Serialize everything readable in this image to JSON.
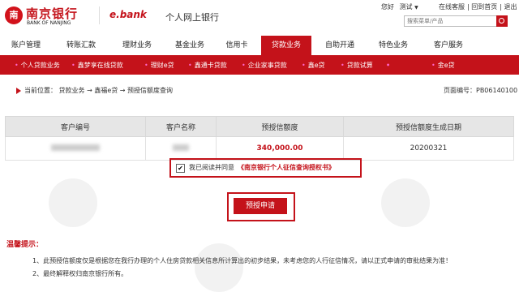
{
  "header": {
    "logo_seal": "南",
    "bank_name": "南京银行",
    "bank_name_en": "BANK OF NANJING",
    "ebank": "e.bank",
    "site_title": "个人网上银行",
    "greeting": "您好",
    "user": "测试",
    "links": [
      "在线客服",
      "回到首页",
      "退出"
    ],
    "search_placeholder": "搜索菜单/产品"
  },
  "main_nav": {
    "items": [
      "账户管理",
      "转账汇款",
      "理财业务",
      "基金业务",
      "信用卡",
      "贷款业务",
      "自助开通",
      "特色业务",
      "客户服务"
    ],
    "active": "贷款业务"
  },
  "sub_nav": {
    "items": [
      "个人贷款业务",
      "鑫梦享在线贷款",
      "理财e贷",
      "鑫通卡贷款",
      "企业家事贷款",
      "鑫e贷",
      "贷款试算",
      "",
      "金e贷"
    ],
    "active_index": 7
  },
  "breadcrumb": {
    "text": "当前位置：  贷款业务 → 鑫福e贷 → 预授信额度查询",
    "page_no": "页面编号：PB06140100"
  },
  "table": {
    "headers": [
      "客户编号",
      "客户名称",
      "预授信额度",
      "预授信额度生成日期"
    ],
    "rows": [
      {
        "customer_no": "",
        "customer_name": "",
        "amount": "340,000.00",
        "date": "20200321"
      }
    ]
  },
  "agreement": {
    "checked_mark": "✔",
    "label": "我已阅读并同意",
    "link": "《南京银行个人征信查询授权书》"
  },
  "apply_button": "预授申请",
  "tips": {
    "title": "温馨提示：",
    "items": [
      "1、此预授信额度仅是根据您在我行办理的个人住房贷款相关信息所计算出的初步结果，未考虑您的人行征信情况，请以正式申请的审批结果为准！",
      "2、最终解释权归南京银行所有。"
    ]
  },
  "colors": {
    "brand": "#c4121a",
    "subnav_active": "#ffd65c"
  }
}
